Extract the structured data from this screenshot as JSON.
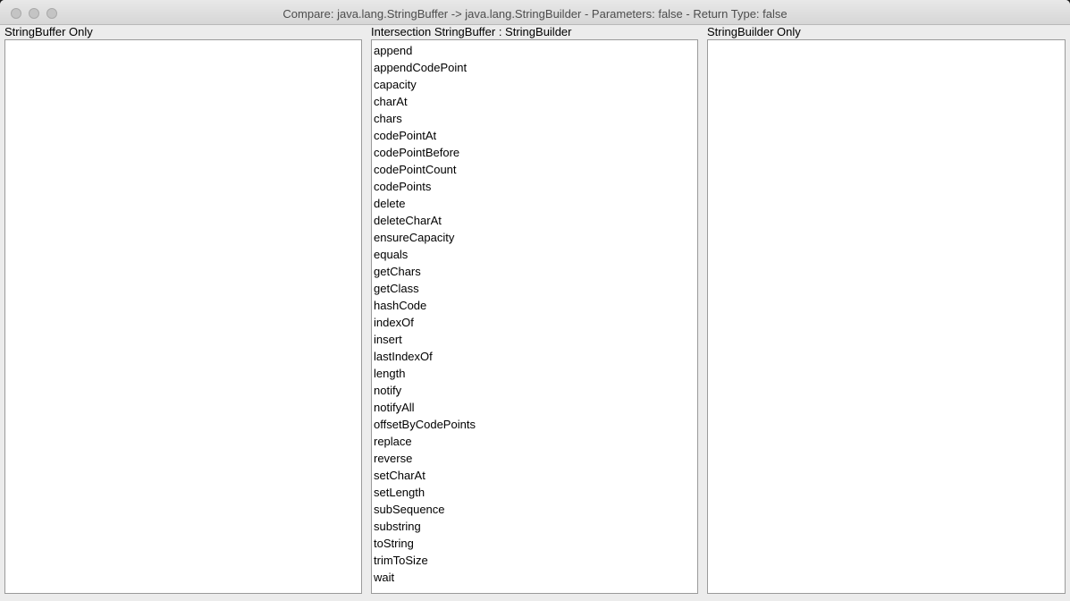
{
  "window": {
    "title": "Compare: java.lang.StringBuffer -> java.lang.StringBuilder - Parameters: false - Return Type: false"
  },
  "left_panel": {
    "label": "StringBuffer Only",
    "items": []
  },
  "middle_panel": {
    "label": "Intersection StringBuffer : StringBuilder",
    "items": [
      "append",
      "appendCodePoint",
      "capacity",
      "charAt",
      "chars",
      "codePointAt",
      "codePointBefore",
      "codePointCount",
      "codePoints",
      "delete",
      "deleteCharAt",
      "ensureCapacity",
      "equals",
      "getChars",
      "getClass",
      "hashCode",
      "indexOf",
      "insert",
      "lastIndexOf",
      "length",
      "notify",
      "notifyAll",
      "offsetByCodePoints",
      "replace",
      "reverse",
      "setCharAt",
      "setLength",
      "subSequence",
      "substring",
      "toString",
      "trimToSize",
      "wait"
    ]
  },
  "right_panel": {
    "label": "StringBuilder Only",
    "items": []
  }
}
